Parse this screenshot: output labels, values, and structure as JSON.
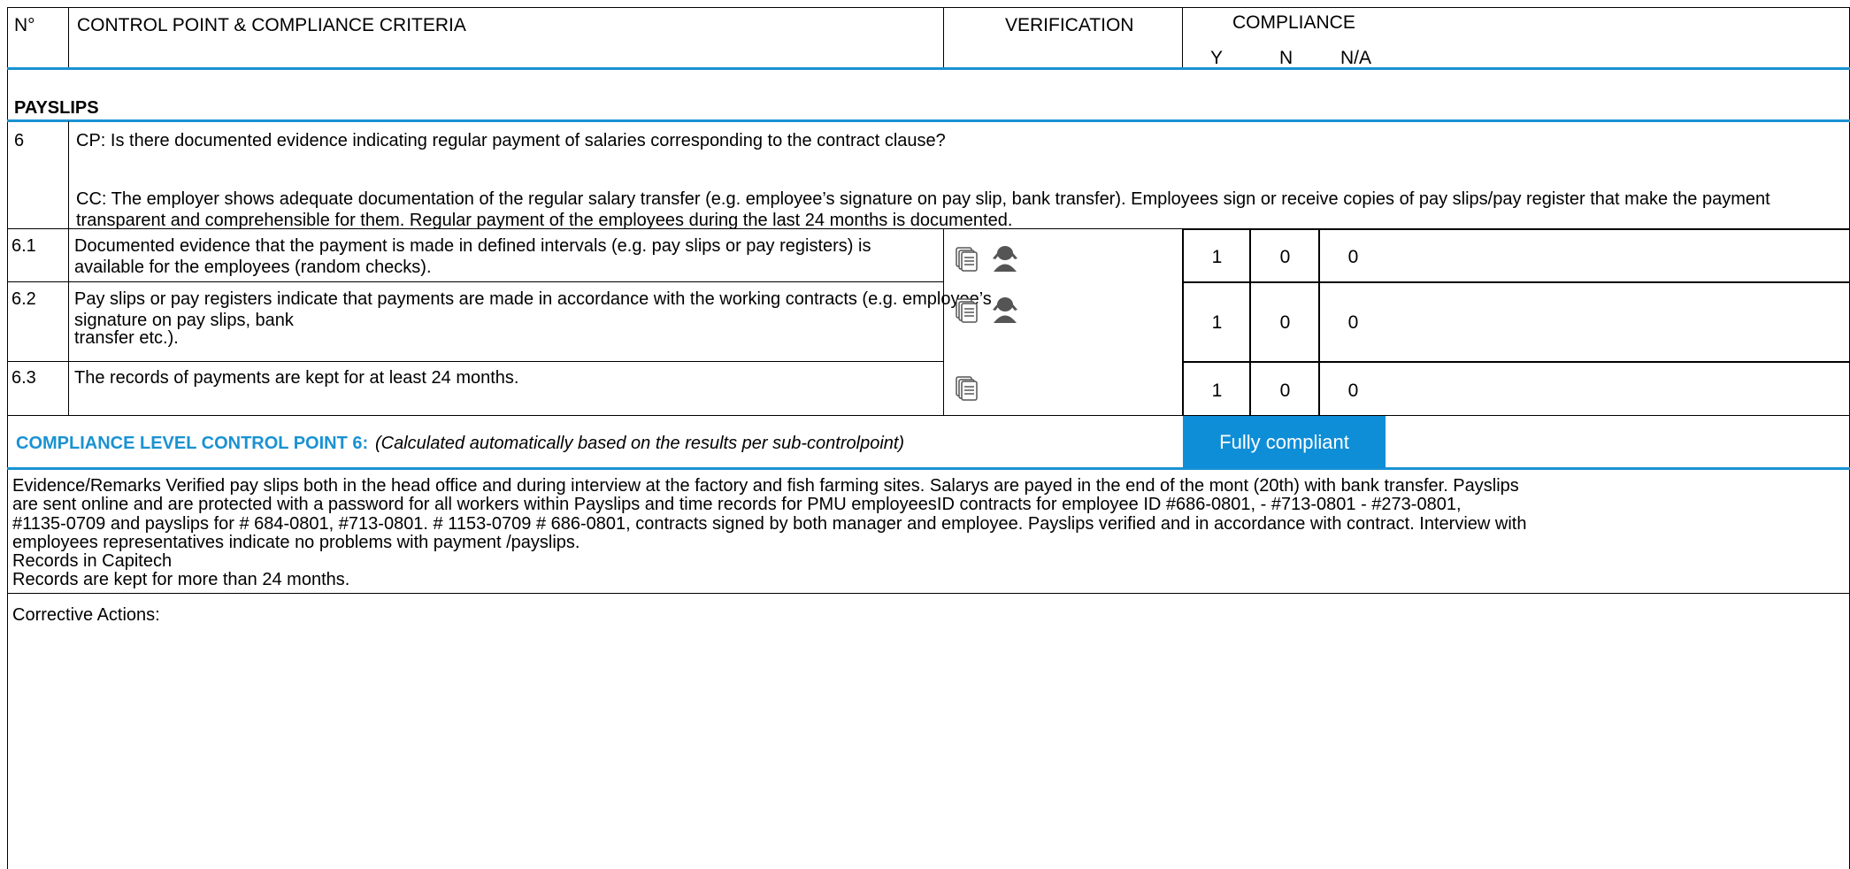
{
  "header": {
    "col_no": "N°",
    "col_control": "CONTROL POINT & COMPLIANCE CRITERIA",
    "col_verification": "VERIFICATION",
    "col_compliance": "COMPLIANCE",
    "col_y": "Y",
    "col_n": "N",
    "col_na": "N/A"
  },
  "section": {
    "title": "PAYSLIPS"
  },
  "control_point": {
    "number": "6",
    "cp_text": "CP: Is there documented evidence indicating regular payment of salaries corresponding to the contract clause?",
    "cc_text": "CC: The employer shows adequate documentation of the regular salary transfer (e.g. employee’s signature on pay slip, bank transfer). Employees sign or receive copies of pay slips/pay register that make the payment transparent and comprehensible for them. Regular payment of the employees during the last 24 months is documented."
  },
  "sub_points": [
    {
      "number": "6.1",
      "text": "Documented evidence that the payment is made in defined intervals (e.g. pay slips or pay registers) is available for the employees (random checks).",
      "icons": [
        "document-stack-icon",
        "interview-person-icon"
      ],
      "y": "1",
      "n": "0",
      "na": "0"
    },
    {
      "number": "6.2",
      "text_lines": [
        "Pay slips or pay registers indicate that payments are made in accordance with the working contracts (e.g. employee’s",
        "signature on pay slips, bank",
        "transfer etc.)."
      ],
      "icons": [
        "document-stack-icon",
        "interview-person-icon"
      ],
      "y": "1",
      "n": "0",
      "na": "0"
    },
    {
      "number": "6.3",
      "text": "The records of payments are kept for at least 24 months.",
      "icons": [
        "document-stack-icon"
      ],
      "y": "1",
      "n": "0",
      "na": "0"
    }
  ],
  "compliance_level": {
    "label": "COMPLIANCE LEVEL CONTROL POINT 6:",
    "note": "(Calculated automatically based on the results per sub-controlpoint)",
    "result": "Fully compliant"
  },
  "evidence": {
    "lines": [
      "Evidence/Remarks Verified pay slips both in the head office and during interview at the factory and fish farming sites. Salarys are payed in the end of the mont (20th) with bank transfer. Payslips",
      "are sent online and are protected with a password for all workers within Payslips and time records for PMU employeesID   contracts for  employee ID  #686-0801,  - #713-0801 - #273-0801,",
      "#1135-0709 and payslips for # 684-0801, #713-0801. # 1153-0709 # 686-0801, contracts signed by both manager and employee. Payslips verified and in accordance with contract. Interview with",
      "employees representatives indicate no problems with payment /payslips.",
      "Records in Capitech",
      "Records are kept for more than 24 months."
    ]
  },
  "corrective": {
    "label": "Corrective Actions:"
  },
  "colors": {
    "accent": "#1a92d2",
    "badge": "#0f8ed8",
    "icon": "#555555"
  }
}
